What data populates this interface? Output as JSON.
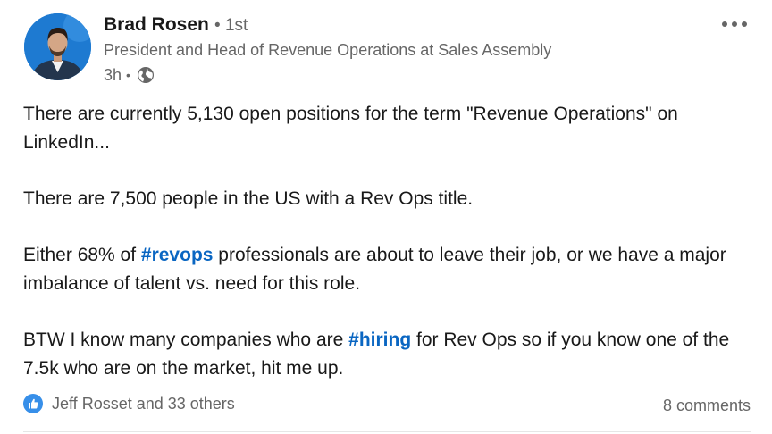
{
  "author": {
    "name": "Brad Rosen",
    "degree": "1st",
    "degree_separator": "•",
    "headline": "President and Head of Revenue Operations at Sales Assembly",
    "time": "3h",
    "time_separator": "•",
    "visibility_icon": "globe-icon",
    "avatar_icon": "avatar"
  },
  "post": {
    "paragraph1": "There are currently 5,130 open positions for the term \"Revenue Operations\" on LinkedIn...",
    "paragraph2": "There are 7,500 people in the US with a Rev Ops title.",
    "paragraph3_before": "Either 68% of ",
    "paragraph3_hashtag": "#revops",
    "paragraph3_after": " professionals are about to leave their job, or we have a major imbalance of talent vs. need for this role.",
    "paragraph4_before": "BTW I know many companies who are ",
    "paragraph4_hashtag": "#hiring",
    "paragraph4_after": " for Rev Ops so if you know one of the 7.5k who are on the market, hit me up."
  },
  "social": {
    "reactions_text": "Jeff Rosset and 33 others",
    "reaction_icon": "like-icon",
    "comments_text": "8 comments"
  },
  "menu": {
    "icon": "more-options-icon"
  },
  "colors": {
    "hashtag": "#0a66c2",
    "muted": "#666666",
    "like": "#378fe9"
  }
}
